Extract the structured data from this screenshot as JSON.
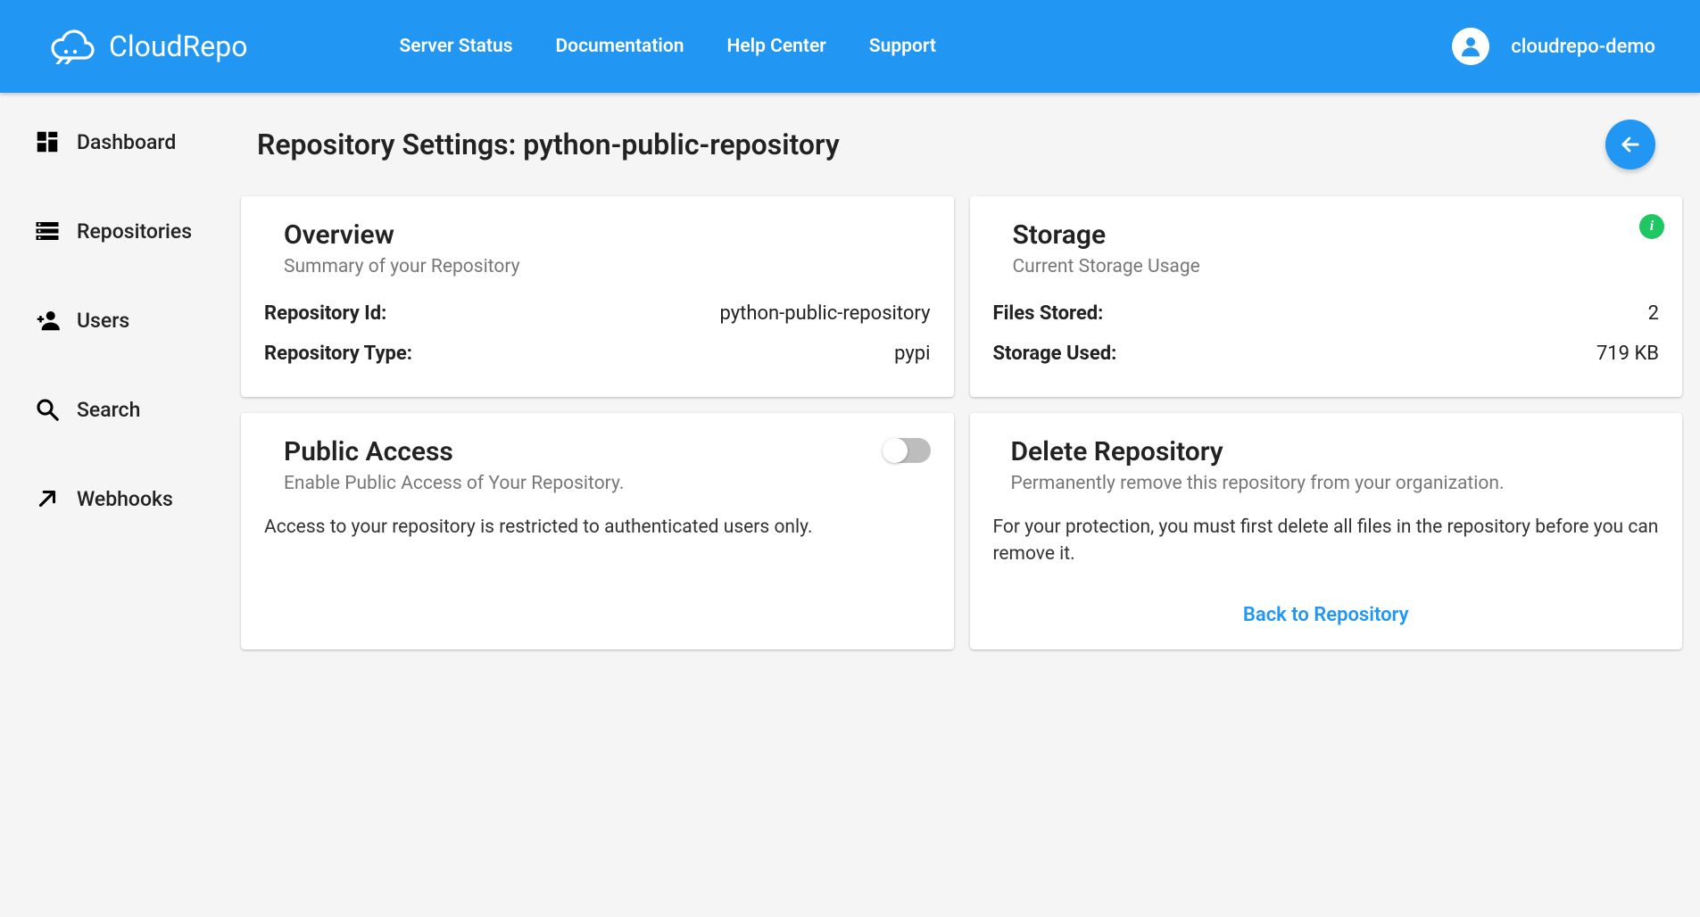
{
  "header": {
    "brand": "CloudRepo",
    "nav": [
      "Server Status",
      "Documentation",
      "Help Center",
      "Support"
    ],
    "username": "cloudrepo-demo"
  },
  "sidebar": {
    "items": [
      {
        "label": "Dashboard"
      },
      {
        "label": "Repositories"
      },
      {
        "label": "Users"
      },
      {
        "label": "Search"
      },
      {
        "label": "Webhooks"
      }
    ]
  },
  "page": {
    "title": "Repository Settings: python-public-repository"
  },
  "overview": {
    "title": "Overview",
    "subtitle": "Summary of your Repository",
    "rows": [
      {
        "k": "Repository Id:",
        "v": "python-public-repository"
      },
      {
        "k": "Repository Type:",
        "v": "pypi"
      }
    ]
  },
  "storage": {
    "title": "Storage",
    "subtitle": "Current Storage Usage",
    "rows": [
      {
        "k": "Files Stored:",
        "v": "2"
      },
      {
        "k": "Storage Used:",
        "v": "719 KB"
      }
    ]
  },
  "publicAccess": {
    "title": "Public Access",
    "subtitle": "Enable Public Access of Your Repository.",
    "body": "Access to your repository is restricted to authenticated users only.",
    "enabled": false
  },
  "deleteRepo": {
    "title": "Delete Repository",
    "subtitle": "Permanently remove this repository from your organization.",
    "body": "For your protection, you must first delete all files in the repository before you can remove it.",
    "action": "Back to Repository"
  }
}
